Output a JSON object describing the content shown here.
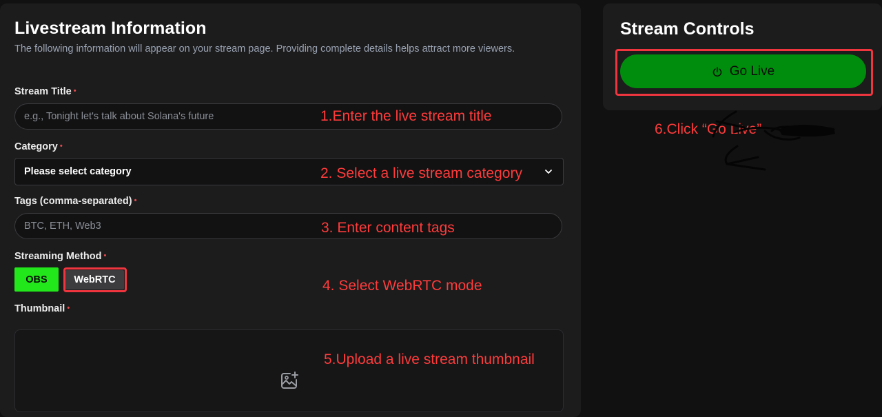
{
  "livestream": {
    "title": "Livestream Information",
    "description": "The following information will appear on your stream page. Providing complete details helps attract more viewers.",
    "stream_title_label": "Stream Title",
    "stream_title_placeholder": "e.g., Tonight let's talk about Solana's future",
    "category_label": "Category",
    "category_value": "Please select category",
    "tags_label": "Tags (comma-separated)",
    "tags_placeholder": "BTC, ETH, Web3",
    "method_label": "Streaming Method",
    "method_options": [
      "OBS",
      "WebRTC"
    ],
    "thumbnail_label": "Thumbnail",
    "required_marker": "•"
  },
  "controls": {
    "title": "Stream Controls",
    "go_live_label": "Go Live"
  },
  "annotations": {
    "step1": "1.Enter the live stream title",
    "step2": "2. Select a live stream category",
    "step3": "3. Enter content tags",
    "step4": "4. Select WebRTC mode",
    "step5": "5.Upload a live stream thumbnail",
    "step6": "6.Click “Go Live”"
  },
  "colors": {
    "background": "#111111",
    "panel": "#1c1c1d",
    "obs_active": "#22e71a",
    "go_live": "#008c0c",
    "annotation_red": "#ff3b3b"
  },
  "icons": {
    "power": "power-icon",
    "chevron": "chevron-down-icon",
    "image_add": "image-add-icon"
  }
}
